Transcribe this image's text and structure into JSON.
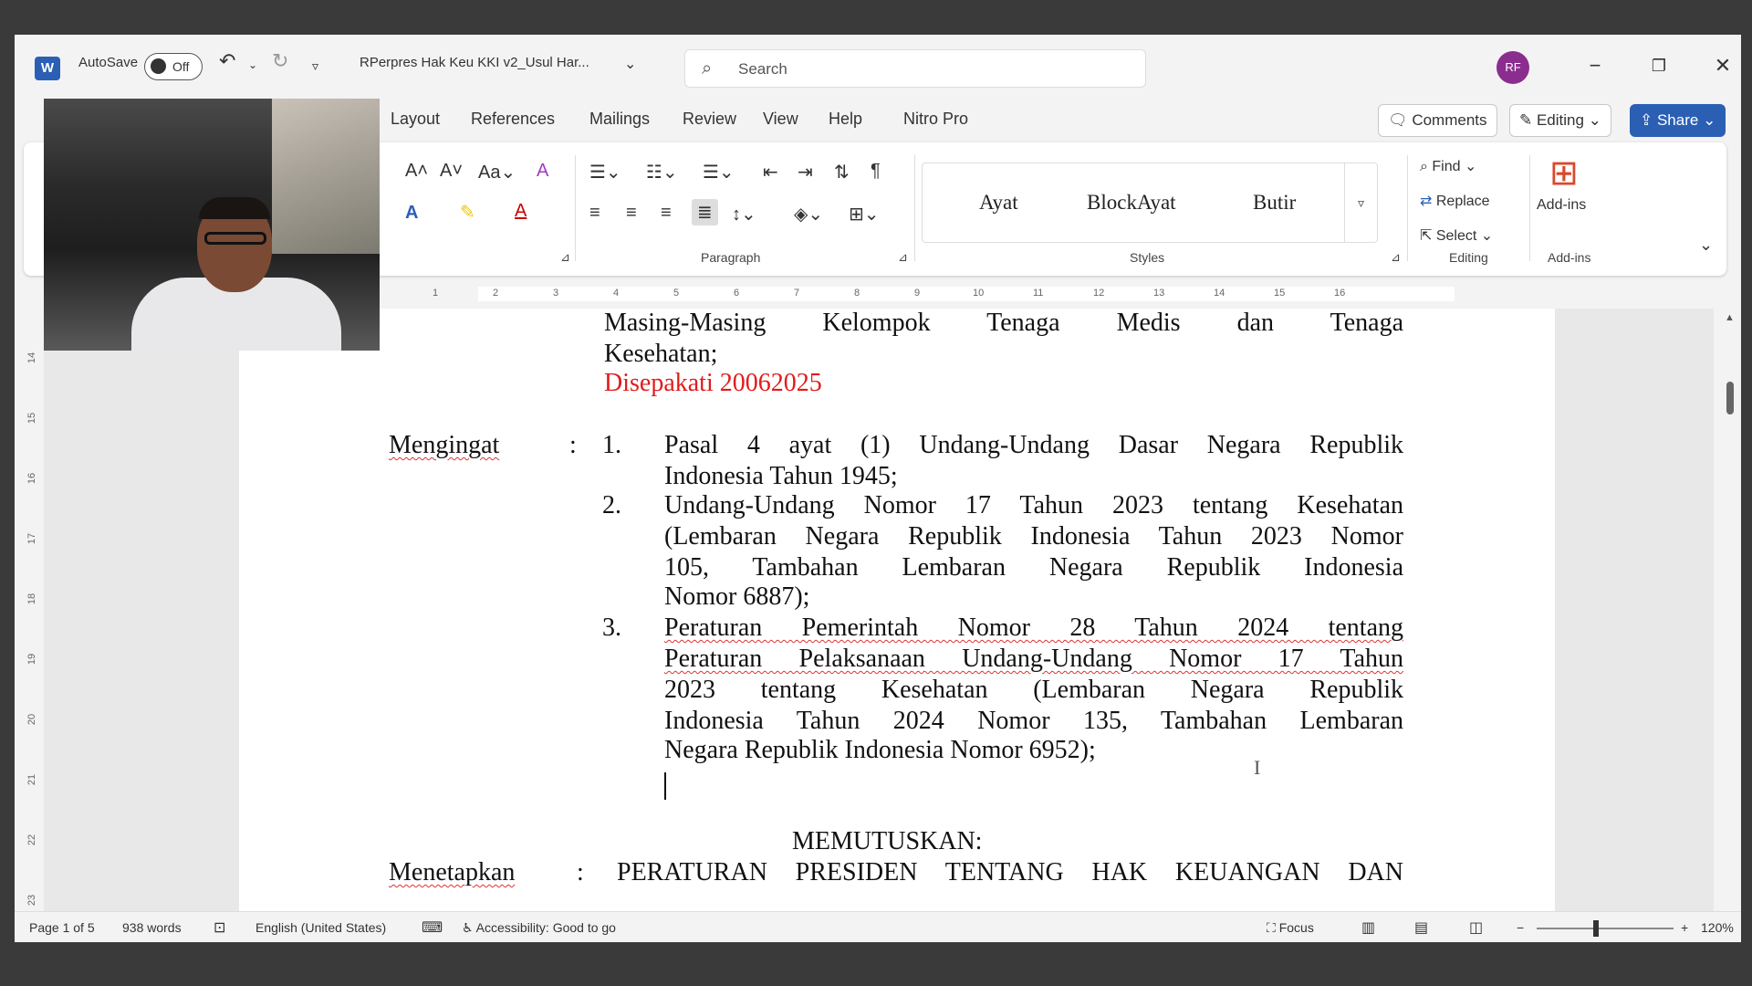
{
  "titlebar": {
    "autosave_label": "AutoSave",
    "autosave_state": "Off",
    "doc_title": "RPerpres Hak Keu KKI v2_Usul Har...",
    "search_placeholder": "Search",
    "user_initials": "RF"
  },
  "ribbon_tabs": [
    "Layout",
    "References",
    "Mailings",
    "Review",
    "View",
    "Help",
    "Nitro Pro"
  ],
  "actions": {
    "comments": "Comments",
    "editing": "Editing",
    "share": "Share"
  },
  "ribbon": {
    "paragraph_label": "Paragraph",
    "styles_label": "Styles",
    "editing_label": "Editing",
    "addins_label": "Add-ins",
    "styles": [
      "Ayat",
      "BlockAyat",
      "Butir"
    ],
    "find": "Find",
    "replace": "Replace",
    "select": "Select",
    "addins": "Add-ins"
  },
  "ruler_ticks": [
    "1",
    "2",
    "3",
    "4",
    "5",
    "6",
    "7",
    "8",
    "9",
    "10",
    "11",
    "12",
    "13",
    "14",
    "15",
    "16"
  ],
  "vruler_ticks": [
    "14",
    "15",
    "16",
    "17",
    "18",
    "19",
    "20",
    "21",
    "22",
    "23"
  ],
  "document": {
    "line_a": "Masing-Masing Kelompok Tenaga Medis dan Tenaga",
    "line_b": "Kesehatan;",
    "agreed": "Disepakati 20062025",
    "mengingat_label": "Mengingat",
    "colon": ":",
    "items": [
      {
        "num": "1.",
        "lines": [
          "Pasal 4 ayat (1) Undang-Undang Dasar Negara Republik",
          "Indonesia Tahun 1945;"
        ]
      },
      {
        "num": "2.",
        "lines": [
          "Undang-Undang Nomor 17 Tahun 2023 tentang Kesehatan",
          "(Lembaran Negara Republik Indonesia Tahun 2023 Nomor",
          "105, Tambahan Lembaran Negara Republik Indonesia",
          "Nomor 6887);"
        ]
      },
      {
        "num": "3.",
        "lines": [
          "Peraturan Pemerintah Nomor 28 Tahun 2024 tentang",
          "Peraturan Pelaksanaan Undang-Undang Nomor 17 Tahun",
          "2023 tentang Kesehatan (Lembaran Negara Republik",
          "Indonesia Tahun 2024 Nomor 135, Tambahan Lembaran",
          "Negara Republik Indonesia Nomor 6952);"
        ]
      }
    ],
    "memutuskan": "MEMUTUSKAN:",
    "menetapkan_label": "Menetapkan",
    "menetapkan_text": "PERATURAN PRESIDEN TENTANG HAK KEUANGAN DAN"
  },
  "status": {
    "page": "Page 1 of 5",
    "words": "938 words",
    "language": "English (United States)",
    "accessibility": "Accessibility: Good to go",
    "focus": "Focus",
    "zoom": "120%"
  }
}
